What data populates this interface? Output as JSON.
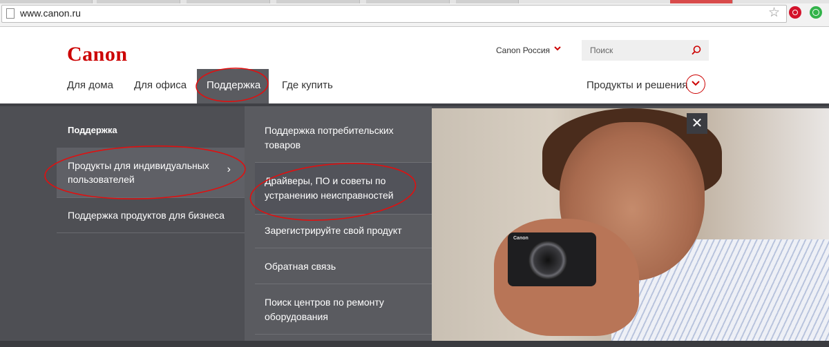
{
  "browser": {
    "url": "www.canon.ru"
  },
  "header": {
    "logo_text": "Canon",
    "region": "Canon Россия",
    "search_placeholder": "Поиск"
  },
  "nav": {
    "items": [
      "Для дома",
      "Для офиса",
      "Поддержка",
      "Где купить"
    ],
    "active": "Поддержка",
    "products_label": "Продукты и решения"
  },
  "menu": {
    "column1": {
      "title": "Поддержка",
      "items": [
        {
          "line1": "Продукты для индивидуальных",
          "line2": "пользователей"
        },
        {
          "line1": "Поддержка продуктов для бизнеса",
          "line2": ""
        }
      ]
    },
    "column2": {
      "items": [
        {
          "line1": "Поддержка потребительских",
          "line2": "товаров"
        },
        {
          "line1": "Драйверы, ПО и советы по",
          "line2": "устранению неисправностей"
        },
        {
          "line1": "Зарегистрируйте свой продукт",
          "line2": ""
        },
        {
          "line1": "Обратная связь",
          "line2": ""
        },
        {
          "line1": "Поиск центров по ремонту",
          "line2": "оборудования"
        }
      ]
    },
    "camera_brand": "Canon"
  },
  "icons": {
    "star": "star-icon",
    "close": "close-icon",
    "search": "search-icon",
    "chevron": "chevron-down-icon"
  },
  "colors": {
    "brand_red": "#cc0000",
    "menu_bg": "#4e4f54",
    "menu_col2_bg": "#5a5b60",
    "annotation_red": "#e01010"
  }
}
